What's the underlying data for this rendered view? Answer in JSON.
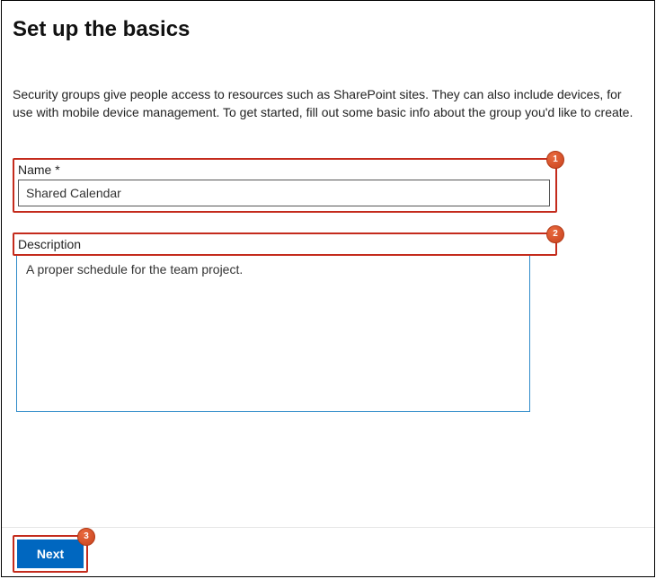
{
  "title": "Set up the basics",
  "intro": "Security groups give people access to resources such as SharePoint sites. They can also include devices, for use with mobile device management. To get started, fill out some basic info about the group you'd like to create.",
  "fields": {
    "name": {
      "label": "Name *",
      "value": "Shared Calendar"
    },
    "description": {
      "label": "Description",
      "value": "A proper schedule for the team project."
    }
  },
  "buttons": {
    "next": "Next"
  },
  "annotations": {
    "badge1": "1",
    "badge2": "2",
    "badge3": "3"
  }
}
